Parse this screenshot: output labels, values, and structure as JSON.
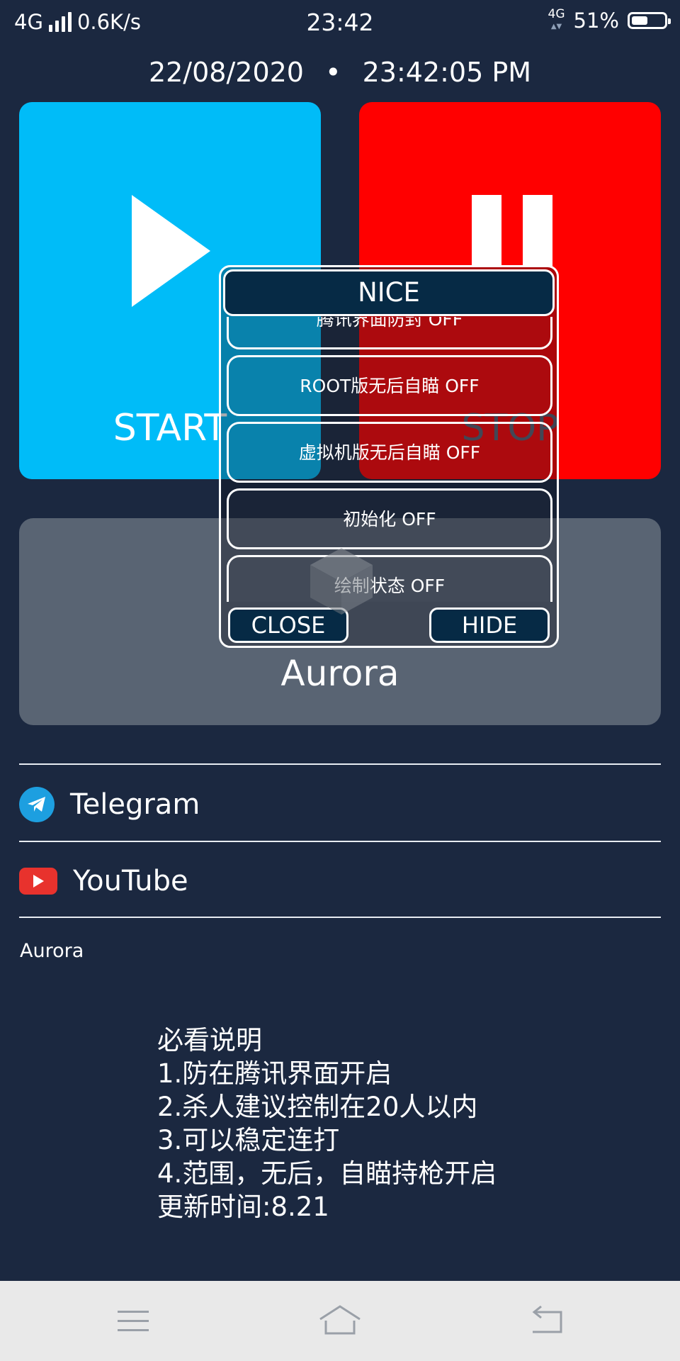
{
  "status_bar": {
    "network": "4G",
    "speed": "0.6K/s",
    "time": "23:42",
    "secondary_network": "4G",
    "battery_percent": "51%",
    "battery_level": 0.51
  },
  "datetime": {
    "date": "22/08/2020",
    "separator": "•",
    "clock": "23:42:05 PM"
  },
  "controls": {
    "start_label": "START",
    "stop_label": "STOP",
    "start_color": "#00bcf8",
    "stop_color": "#ff0000"
  },
  "app_card": {
    "title": "Aurora"
  },
  "links": [
    {
      "label": "Telegram",
      "icon": "telegram-icon"
    },
    {
      "label": "YouTube",
      "icon": "youtube-icon"
    }
  ],
  "footer": {
    "name": "Aurora",
    "notes": [
      "必看说明",
      "1.防在腾讯界面开启",
      "2.杀人建议控制在20人以内",
      "3.可以稳定连打",
      "4.范围，无后，自瞄持枪开启",
      "更新时间:8.21"
    ]
  },
  "dialog": {
    "title": "NICE",
    "items": [
      "腾讯界面防封 OFF",
      "ROOT版无后自瞄 OFF",
      "虚拟机版无后自瞄 OFF",
      "初始化 OFF",
      "绘制状态 OFF"
    ],
    "close_label": "CLOSE",
    "hide_label": "HIDE"
  },
  "nav": {
    "icons": [
      "menu-icon",
      "home-icon",
      "back-icon"
    ]
  }
}
